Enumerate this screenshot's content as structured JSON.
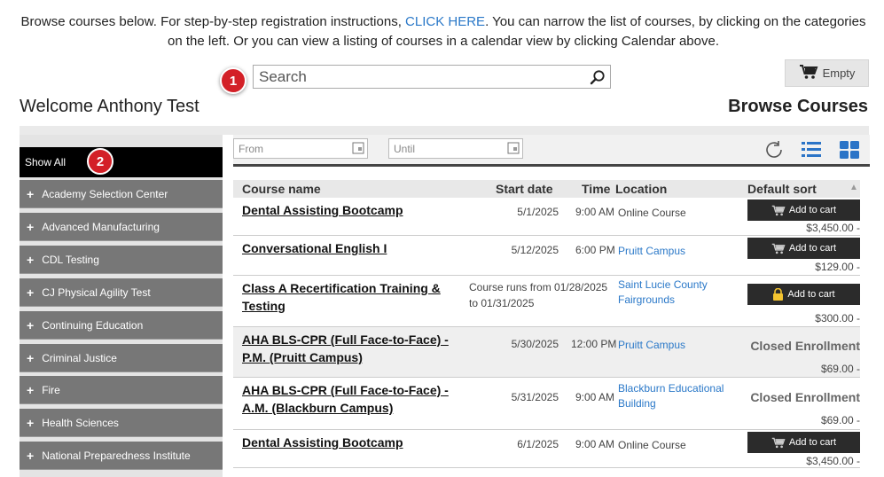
{
  "intro": {
    "before_link": "Browse courses below. For step-by-step registration instructions, ",
    "link": "CLICK HERE",
    "after_link": ".  You can narrow the list of courses, by clicking on the categories on the left.  Or you can view a listing of courses in a calendar view by clicking Calendar above."
  },
  "markers": {
    "m1": "1",
    "m2": "2"
  },
  "search": {
    "placeholder": "Search",
    "icon": "magnifier-icon"
  },
  "cart": {
    "label": "Empty",
    "icon": "shopping-cart-icon"
  },
  "welcome": "Welcome Anthony Test",
  "browse_title": "Browse Courses",
  "sidebar": {
    "show_all": "Show All",
    "categories": [
      "Academy Selection Center",
      "Advanced Manufacturing",
      "CDL Testing",
      "CJ Physical Agility Test",
      "Continuing Education",
      "Criminal Justice",
      "Fire",
      "Health Sciences",
      "National Preparedness Institute"
    ]
  },
  "filter": {
    "from_placeholder": "From",
    "until_placeholder": "Until"
  },
  "table": {
    "headers": {
      "name": "Course name",
      "start": "Start date",
      "time": "Time",
      "location": "Location",
      "sort": "Default sort"
    },
    "add_label": "Add to cart",
    "closed_label": "Closed Enrollment",
    "rows": [
      {
        "name": "Dental Assisting Bootcamp",
        "date": "5/1/2025",
        "time": "9:00 AM",
        "location": "Online Course",
        "price": "$3,450.00 -",
        "action": "Add to cart"
      },
      {
        "name": "Conversational English I",
        "date": "5/12/2025",
        "time": "6:00 PM",
        "location": "Pruitt Campus",
        "price": "$129.00 -",
        "action": "Add to cart"
      },
      {
        "name": "Class A Recertification Training & Testing",
        "date": "Course runs from 01/28/2025 to 01/31/2025",
        "time": "",
        "location": "Saint Lucie County Fairgrounds",
        "price": "$300.00 -",
        "action": "Add to cart"
      },
      {
        "name": "AHA BLS-CPR (Full Face-to-Face) - P.M. (Pruitt Campus)",
        "date": "5/30/2025",
        "time": "12:00 PM",
        "location": "Pruitt Campus",
        "price": "$69.00 -",
        "action": "Closed Enrollment"
      },
      {
        "name": "AHA BLS-CPR (Full Face-to-Face) - A.M. (Blackburn Campus)",
        "date": "5/31/2025",
        "time": "9:00 AM",
        "location": "Blackburn Educational Building",
        "price": "$69.00 -",
        "action": "Closed Enrollment"
      },
      {
        "name": "Dental Assisting Bootcamp",
        "date": "6/1/2025",
        "time": "9:00 AM",
        "location": "Online Course",
        "price": "$3,450.00 -",
        "action": "Add to cart"
      }
    ]
  }
}
